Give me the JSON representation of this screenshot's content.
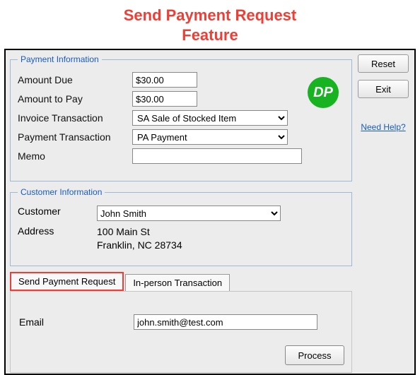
{
  "title_line1": "Send Payment Request",
  "title_line2": "Feature",
  "logo_text": "DP",
  "side": {
    "reset_label": "Reset",
    "exit_label": "Exit",
    "help_label": "Need Help?"
  },
  "payment": {
    "legend": "Payment Information",
    "amount_due_label": "Amount Due",
    "amount_due_value": "$30.00",
    "amount_to_pay_label": "Amount to Pay",
    "amount_to_pay_value": "$30.00",
    "invoice_tx_label": "Invoice Transaction",
    "invoice_tx_value": "SA  Sale of Stocked Item",
    "payment_tx_label": "Payment Transaction",
    "payment_tx_value": "PA  Payment",
    "memo_label": "Memo",
    "memo_value": ""
  },
  "customer": {
    "legend": "Customer Information",
    "customer_label": "Customer",
    "customer_value": "John Smith",
    "address_label": "Address",
    "address_value": "100 Main St\nFranklin, NC 28734"
  },
  "tabs": {
    "send_payment_request": "Send Payment Request",
    "in_person": "In-person Transaction"
  },
  "email": {
    "label": "Email",
    "value": "john.smith@test.com"
  },
  "process_label": "Process"
}
